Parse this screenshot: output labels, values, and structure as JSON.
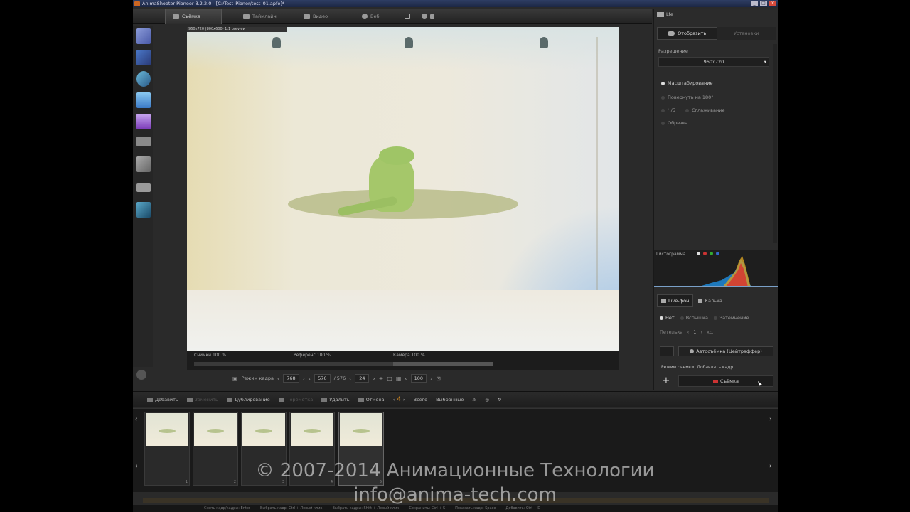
{
  "window": {
    "title": "AnimaShooter Pioneer 3.2.2.0 - [C:/Test_Pioner/test_01.apfe]*",
    "minimize": "_",
    "maximize": "□",
    "close": "×"
  },
  "tabs": [
    {
      "label": "Съёмка",
      "icon": "camera-icon"
    },
    {
      "label": "Таймлайн",
      "icon": "timeline-icon"
    },
    {
      "label": "Видео",
      "icon": "film-icon"
    },
    {
      "label": "Веб",
      "icon": "globe-icon"
    }
  ],
  "viewport": {
    "overlay_text": "960x720 (800x600) 1:1 preview"
  },
  "onion": [
    {
      "label": "Снимки 100 %"
    },
    {
      "label": "Референс 100 %"
    },
    {
      "label": "Камера 100 %"
    }
  ],
  "controls": {
    "mode_label": "Режим кадра",
    "frame_value": "768",
    "position": "576",
    "of": "/ 576",
    "fps": "24",
    "zoom": "100"
  },
  "right_panel": {
    "header": "Lfe",
    "tab_display": "Отобразить",
    "tab_other": "Установки",
    "resolution_label": "Разрешение",
    "resolution_value": "960x720",
    "opt_scale": "Масштабирование",
    "opt_rotate": "Повернуть на 180°",
    "opt_bw": "Ч/Б",
    "opt_smooth": "Сглаживание",
    "opt_crop": "Обрезка",
    "histogram_label": "Гистограмма",
    "tab_liveview": "Live-фон",
    "tab_tracing": "Калька",
    "radio_none": "Нет",
    "radio_flash": "Вспышка",
    "radio_fade": "Затемнение",
    "loop_label": "Петелька",
    "loop_value": "1",
    "loop_unit": "кс.",
    "auto_shoot": "Автосъёмка (Цейтраффер)",
    "mode_text": "Режим съемки: Добавлять кадр",
    "shoot_label": "Съёмка"
  },
  "toolbar": {
    "add": "Добавить",
    "replace": "Заменить",
    "duplicate": "Дублирование",
    "reference": "Перемотка",
    "delete": "Удалить",
    "undo": "Отмена",
    "step": "4",
    "all": "Всего",
    "selected": "Выбранные"
  },
  "frames": [
    {
      "num": "1"
    },
    {
      "num": "2"
    },
    {
      "num": "3"
    },
    {
      "num": "4"
    },
    {
      "num": "5"
    }
  ],
  "status": [
    "Снять кадр/кадры: Enter",
    "Выбрать кадр: Ctrl + Левый клик",
    "Выбрать кадры: Shift + Левый клик",
    "Сохранить: Ctrl + S",
    "Показать кадр: Space",
    "Добавить: Ctrl + D"
  ],
  "watermark": {
    "line1": "© 2007-2014 Анимационные Технологии",
    "line2": "info@anima-tech.com"
  },
  "colors": {
    "accent": "#e09020",
    "record": "#cc3333",
    "titlebar": "#2e3d63"
  }
}
